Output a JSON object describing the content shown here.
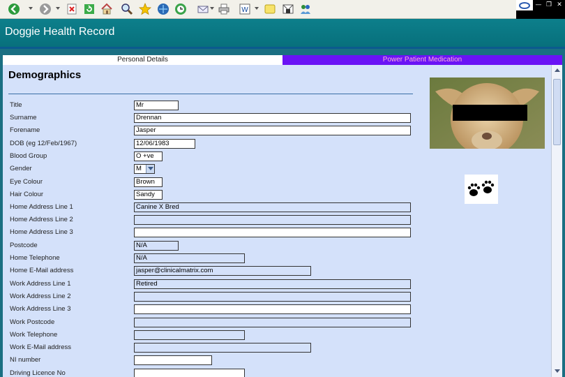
{
  "app": {
    "title": "Doggie Health Record"
  },
  "tabs": [
    {
      "label": "Personal Details"
    },
    {
      "label": "Power Patient Medication"
    }
  ],
  "section": {
    "title": "Demographics"
  },
  "form": {
    "fields": [
      {
        "label": "Title",
        "value": "Mr"
      },
      {
        "label": "Surname",
        "value": "Drennan"
      },
      {
        "label": "Forename",
        "value": "Jasper"
      },
      {
        "label": "DOB (eg 12/Feb/1967)",
        "value": "12/06/1983"
      },
      {
        "label": "Blood Group",
        "value": "O +ve"
      },
      {
        "label": "Gender",
        "value": "M"
      },
      {
        "label": "Eye Colour",
        "value": "Brown"
      },
      {
        "label": "Hair Colour",
        "value": "Sandy"
      },
      {
        "label": "Home Address Line 1",
        "value": "Canine X Bred"
      },
      {
        "label": "Home Address Line 2",
        "value": ""
      },
      {
        "label": "Home Address Line 3",
        "value": ""
      },
      {
        "label": "Postcode",
        "value": "N/A"
      },
      {
        "label": "Home Telephone",
        "value": "N/A"
      },
      {
        "label": "Home E-Mail address",
        "value": "jasper@clinicalmatrix.com"
      },
      {
        "label": "Work Address Line 1",
        "value": "Retired"
      },
      {
        "label": "Work Address Line 2",
        "value": ""
      },
      {
        "label": "Work Address Line 3",
        "value": ""
      },
      {
        "label": "Work Postcode",
        "value": ""
      },
      {
        "label": "Work Telephone",
        "value": ""
      },
      {
        "label": "Work E-Mail address",
        "value": ""
      },
      {
        "label": "NI number",
        "value": ""
      },
      {
        "label": "Driving Licence No",
        "value": ""
      }
    ]
  },
  "colors": {
    "title_bar": "#0d7f8b",
    "panel": "#d4e1fa",
    "medication_tab": "#6a13f5"
  }
}
